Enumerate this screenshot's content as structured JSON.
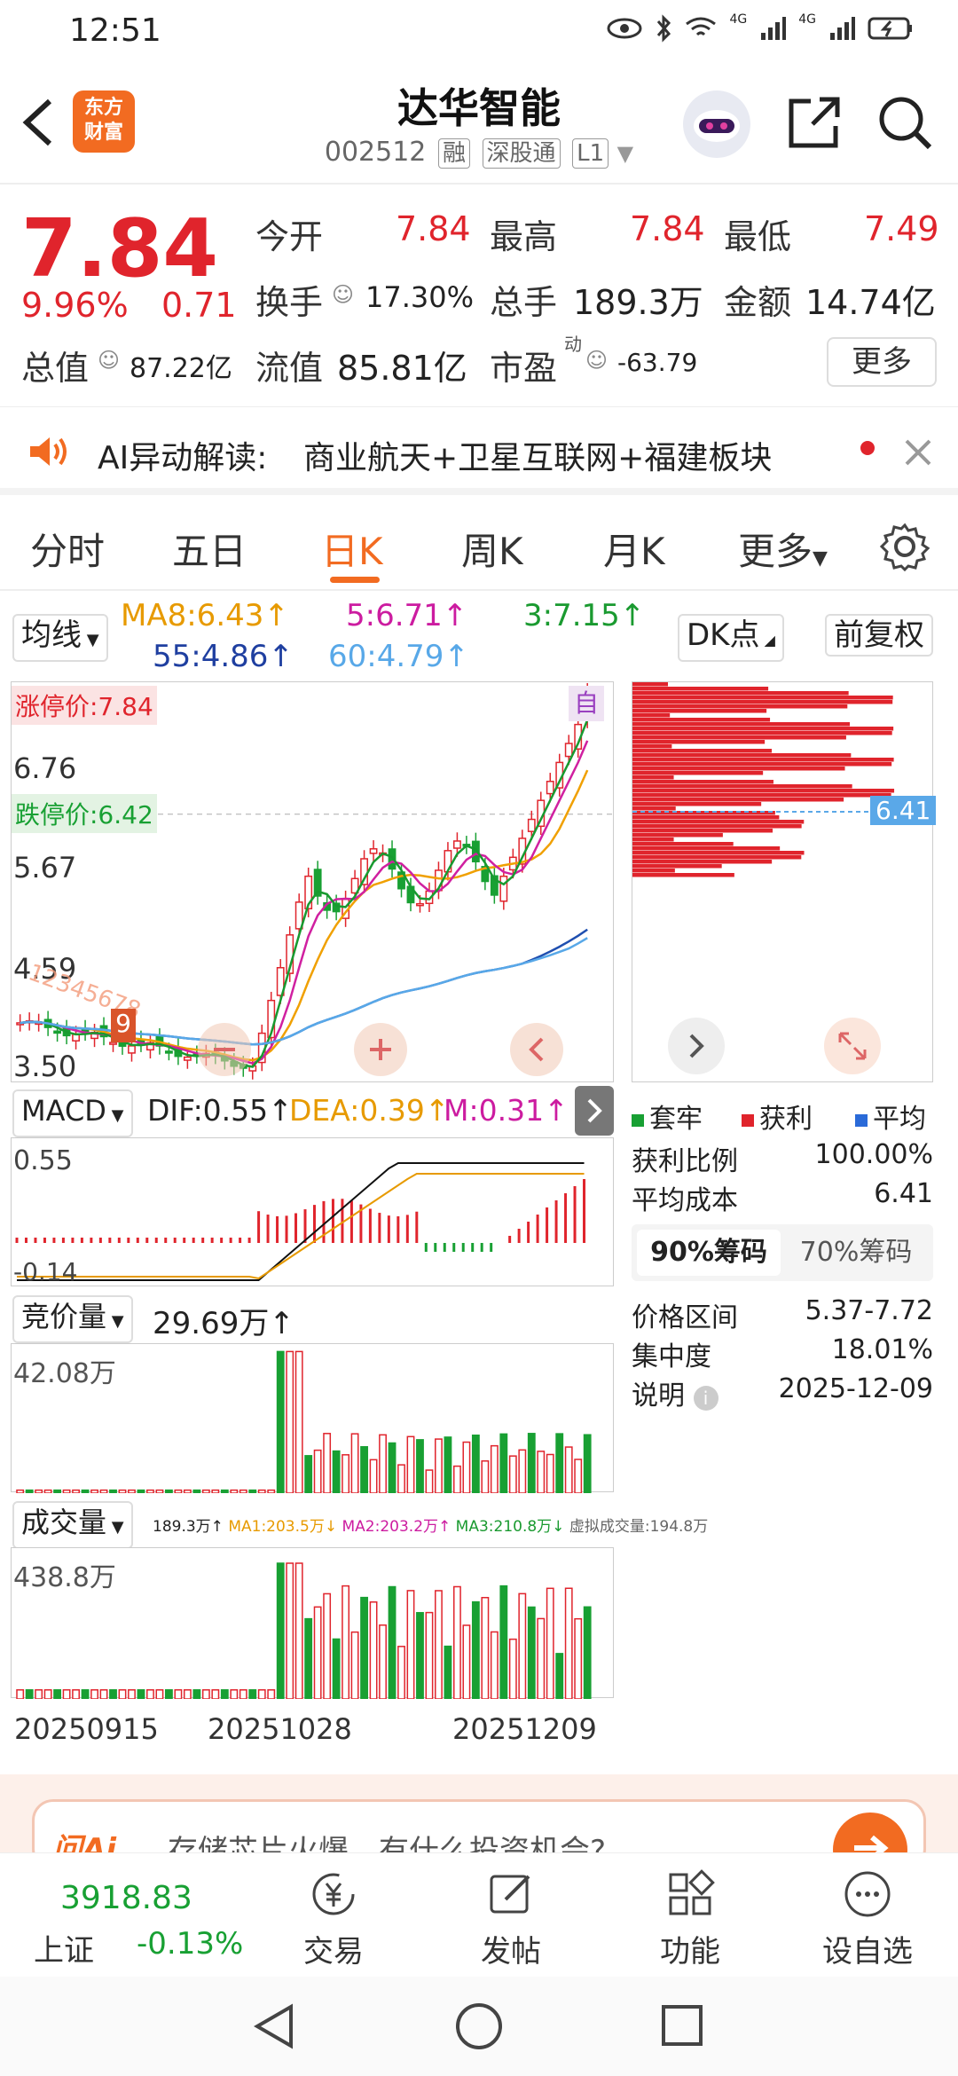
{
  "status": {
    "time": "12:51",
    "net1": "4G",
    "net2": "4G"
  },
  "header": {
    "title": "达华智能",
    "code": "002512",
    "tags": [
      "融",
      "深股通",
      "L1"
    ],
    "logo_line1": "东方",
    "logo_line2": "财富"
  },
  "quote": {
    "price": "7.84",
    "change_pct": "9.96%",
    "change": "0.71",
    "open_label": "今开",
    "open": "7.84",
    "high_label": "最高",
    "high": "7.84",
    "low_label": "最低",
    "low": "7.49",
    "turnover_label": "换手",
    "turnover": "17.30%",
    "volume_label": "总手",
    "volume": "189.3万",
    "amount_label": "金额",
    "amount": "14.74亿",
    "mktcap_label": "总值",
    "mktcap": "87.22亿",
    "float_label": "流值",
    "float": "85.81亿",
    "pe_label": "市盈",
    "pe_sup": "动",
    "pe": "-63.79",
    "more": "更多"
  },
  "ai": {
    "label": "AI异动解读:",
    "text": "商业航天+卫星互联网+福建板块"
  },
  "tabs": [
    "分时",
    "五日",
    "日K",
    "周K",
    "月K",
    "更多"
  ],
  "active_tab": "日K",
  "kline": {
    "ma_label": "均线",
    "ma8": "MA8:6.43↑",
    "ma5": "5:6.71↑",
    "ma3": "3:7.15↑",
    "ma55": "55:4.86↑",
    "ma60": "60:4.79↑",
    "dk": "DK点",
    "fq": "前复权",
    "limit_up": "涨停价:7.84",
    "limit_down": "跌停价:6.42",
    "y_labels": [
      "6.76",
      "5.67",
      "4.59",
      "3.50"
    ],
    "tag_self": "自",
    "numbers": "12345678",
    "nine": "9",
    "colors": {
      "up": "#e0242c",
      "down": "#18a033",
      "ma8": "#f0a000",
      "ma5": "#d020a0",
      "ma3": "#189a30",
      "ma55": "#1f4fb0",
      "ma60": "#58a8e8"
    }
  },
  "chip": {
    "cost_tag": "6.41",
    "legend": [
      "套牢",
      "获利",
      "平均"
    ],
    "rows": [
      {
        "k": "获利比例",
        "v": "100.00%"
      },
      {
        "k": "平均成本",
        "v": "6.41"
      }
    ],
    "tab90": "90%筹码",
    "tab70": "70%筹码",
    "rows2": [
      {
        "k": "价格区间",
        "v": "5.37-7.72"
      },
      {
        "k": "集中度",
        "v": "18.01%"
      },
      {
        "k": "说明",
        "v": "2025-12-09"
      }
    ]
  },
  "macd": {
    "label": "MACD",
    "dif": "DIF:0.55↑",
    "dea": "DEA:0.39↑",
    "m": "M:0.31↑",
    "y_top": "0.55",
    "y_bot": "-0.14"
  },
  "auction": {
    "label": "竞价量",
    "value": "29.69万↑",
    "y_top": "42.08万"
  },
  "vol": {
    "label": "成交量",
    "v": "189.3万↑",
    "ma1": "MA1:203.5万↓",
    "ma2": "MA2:203.2万↑",
    "ma3": "MA3:210.8万↓",
    "virt": "虚拟成交量:194.8万",
    "y_top": "438.8万"
  },
  "dates": [
    "20250915",
    "20251028",
    "20251209"
  ],
  "banner": {
    "text": "存储芯片火爆，有什么投资机会?"
  },
  "bottom": {
    "index_value": "3918.83",
    "index_name": "上证",
    "index_change": "-0.13%",
    "items": [
      "交易",
      "发帖",
      "功能",
      "设自选"
    ]
  }
}
